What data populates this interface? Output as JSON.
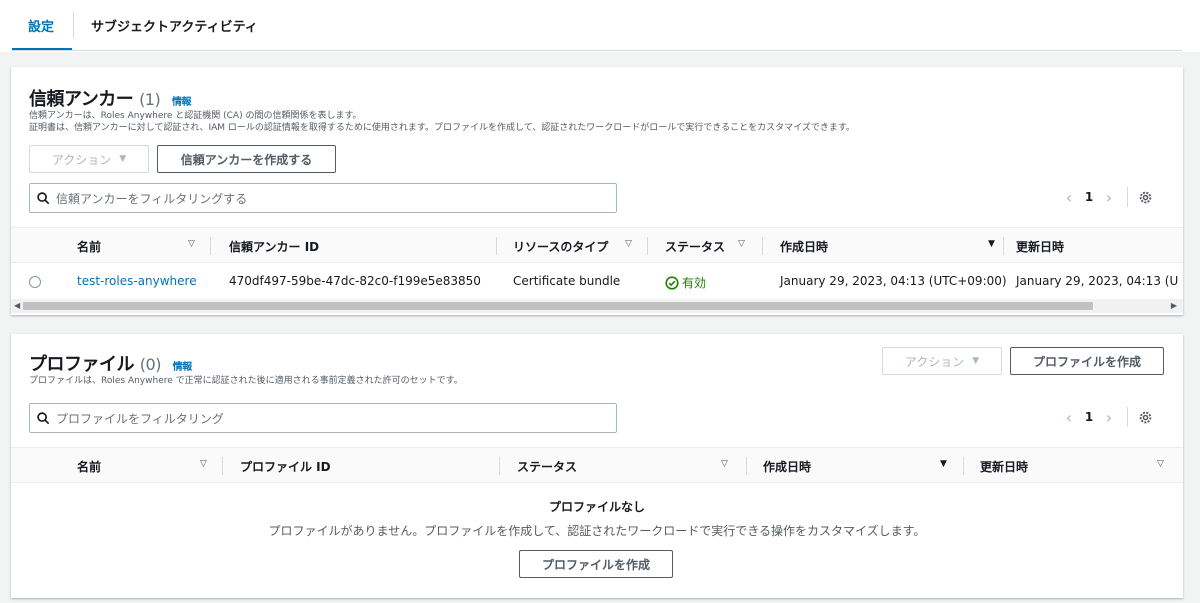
{
  "tabs": {
    "settings": "設定",
    "activity": "サブジェクトアクティビティ"
  },
  "anchor": {
    "title": "信頼アンカー",
    "count": "(1)",
    "info": "情報",
    "desc1": "信頼アンカーは、Roles Anywhere と認証機関 (CA) の間の信頼関係を表します。",
    "desc2": "証明書は、信頼アンカーに対して認証され、IAM ロールの認証情報を取得するために使用されます。プロファイルを作成して、認証されたワークロードがロールで実行できることをカスタマイズできます。",
    "actions_label": "アクション",
    "create_label": "信頼アンカーを作成する",
    "search_placeholder": "信頼アンカーをフィルタリングする",
    "page": "1",
    "columns": {
      "name": "名前",
      "id": "信頼アンカー ID",
      "type": "リソースのタイプ",
      "status": "ステータス",
      "created": "作成日時",
      "updated": "更新日時"
    },
    "rows": [
      {
        "name": "test-roles-anywhere",
        "id": "470df497-59be-47dc-82c0-f199e5e83850",
        "type": "Certificate bundle",
        "status": "有効",
        "created": "January 29, 2023, 04:13 (UTC+09:00)",
        "updated": "January 29, 2023, 04:13 (U"
      }
    ]
  },
  "profile": {
    "title": "プロファイル",
    "count": "(0)",
    "info": "情報",
    "desc": "プロファイルは、Roles Anywhere で正常に認証された後に適用される事前定義された許可のセットです。",
    "actions_label": "アクション",
    "create_label": "プロファイルを作成",
    "search_placeholder": "プロファイルをフィルタリング",
    "page": "1",
    "columns": {
      "name": "名前",
      "id": "プロファイル ID",
      "status": "ステータス",
      "created": "作成日時",
      "updated": "更新日時"
    },
    "empty_title": "プロファイルなし",
    "empty_desc": "プロファイルがありません。プロファイルを作成して、認証されたワークロードで実行できる操作をカスタマイズします。",
    "empty_create_label": "プロファイルを作成"
  },
  "colors": {
    "accent": "#0073bb",
    "success": "#1d8102",
    "text": "#16191f"
  }
}
